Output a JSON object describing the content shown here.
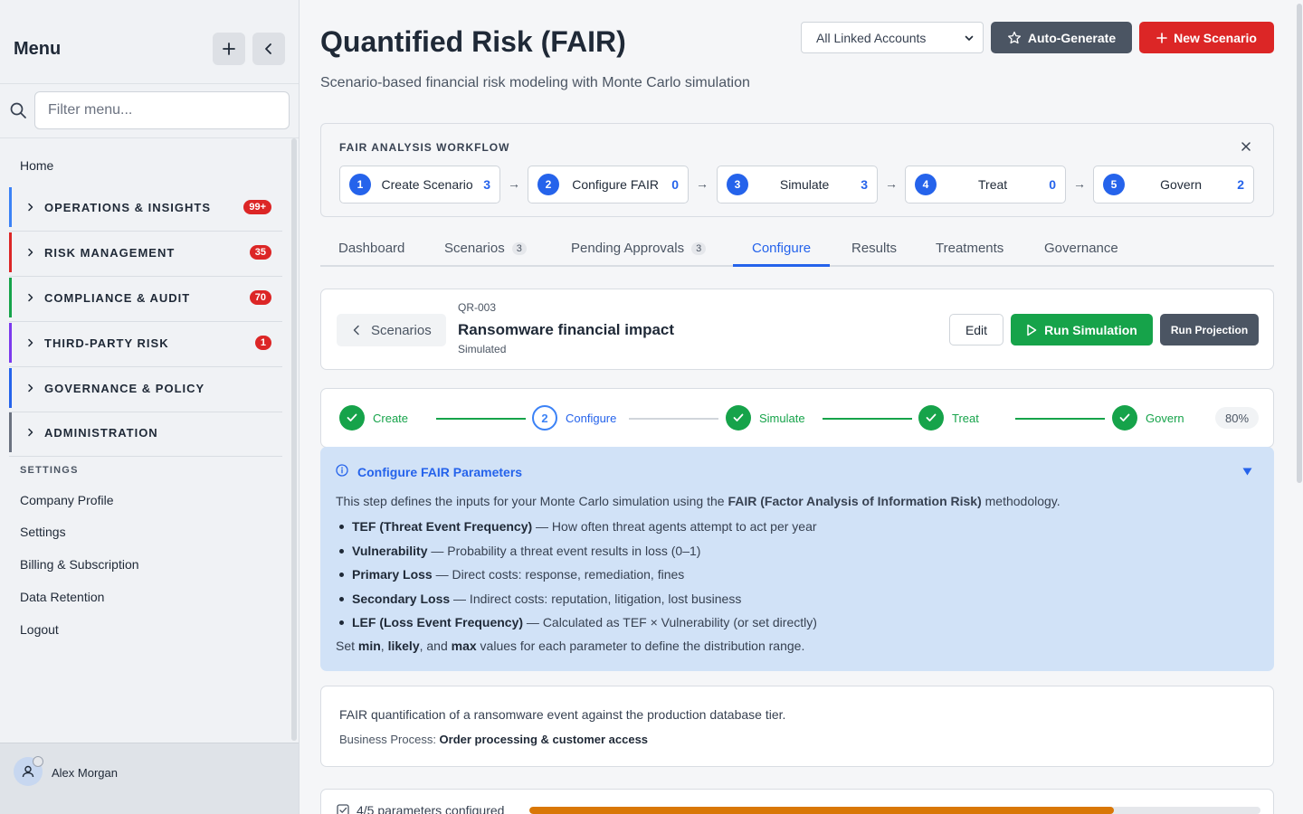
{
  "sidebar": {
    "title": "Menu",
    "search_placeholder": "Filter menu...",
    "home": "Home",
    "groups": [
      {
        "label": "OPERATIONS & INSIGHTS",
        "badge": "99+",
        "color": "#3b82f6"
      },
      {
        "label": "RISK MANAGEMENT",
        "badge": "35",
        "color": "#dc2626"
      },
      {
        "label": "COMPLIANCE & AUDIT",
        "badge": "70",
        "color": "#16a34a"
      },
      {
        "label": "THIRD-PARTY RISK",
        "badge": "1",
        "color": "#7c3aed"
      },
      {
        "label": "GOVERNANCE & POLICY",
        "badge": "",
        "color": "#2563eb"
      },
      {
        "label": "ADMINISTRATION",
        "badge": "",
        "color": "#6b7280"
      }
    ],
    "settings_heading": "SETTINGS",
    "settings_links": [
      "Company Profile",
      "Settings",
      "Billing & Subscription",
      "Data Retention",
      "Logout"
    ],
    "user_name": "Alex Morgan"
  },
  "header": {
    "title": "Quantified Risk (FAIR)",
    "subtitle": "Scenario-based financial risk modeling with Monte Carlo simulation",
    "account_select": "All Linked Accounts",
    "auto_generate": "Auto-Generate",
    "new_scenario": "New Scenario"
  },
  "workflow": {
    "label": "FAIR ANALYSIS WORKFLOW",
    "arrow": "→",
    "steps": [
      {
        "num": "1",
        "name": "Create Scenario",
        "count": "3"
      },
      {
        "num": "2",
        "name": "Configure FAIR",
        "count": "0"
      },
      {
        "num": "3",
        "name": "Simulate",
        "count": "3"
      },
      {
        "num": "4",
        "name": "Treat",
        "count": "0"
      },
      {
        "num": "5",
        "name": "Govern",
        "count": "2"
      }
    ]
  },
  "tabs": [
    {
      "label": "Dashboard",
      "count": ""
    },
    {
      "label": "Scenarios",
      "count": "3"
    },
    {
      "label": "Pending Approvals",
      "count": "3"
    },
    {
      "label": "Configure",
      "count": ""
    },
    {
      "label": "Results",
      "count": ""
    },
    {
      "label": "Treatments",
      "count": ""
    },
    {
      "label": "Governance",
      "count": ""
    }
  ],
  "active_tab": "Configure",
  "scenario": {
    "back_label": "Scenarios",
    "id": "QR-003",
    "title": "Ransomware financial impact",
    "status": "Simulated",
    "edit": "Edit",
    "run_simulation": "Run Simulation",
    "run_projection": "Run Projection"
  },
  "progress": {
    "steps": [
      {
        "label": "Create",
        "state": "done"
      },
      {
        "label": "Configure",
        "state": "current",
        "num": "2"
      },
      {
        "label": "Simulate",
        "state": "done"
      },
      {
        "label": "Treat",
        "state": "done"
      },
      {
        "label": "Govern",
        "state": "done"
      }
    ],
    "percent": "80%"
  },
  "info": {
    "title": "Configure FAIR Parameters",
    "intro_pre": "This step defines the inputs for your Monte Carlo simulation using the ",
    "intro_bold": "FAIR (Factor Analysis of Information Risk)",
    "intro_post": " methodology.",
    "items": [
      {
        "term": "TEF (Threat Event Frequency)",
        "desc": " — How often threat agents attempt to act per year"
      },
      {
        "term": "Vulnerability",
        "desc": " — Probability a threat event results in loss (0–1)"
      },
      {
        "term": "Primary Loss",
        "desc": " — Direct costs: response, remediation, fines"
      },
      {
        "term": "Secondary Loss",
        "desc": " — Indirect costs: reputation, litigation, lost business"
      },
      {
        "term": "LEF (Loss Event Frequency)",
        "desc": " — Calculated as TEF × Vulnerability (or set directly)"
      }
    ],
    "foot": {
      "p1": "Set ",
      "b1": "min",
      "p2": ", ",
      "b2": "likely",
      "p3": ", and ",
      "b3": "max",
      "p4": " values for each parameter to define the distribution range."
    }
  },
  "description": {
    "text": "FAIR quantification of a ransomware event against the production database tier.",
    "bp_label": "Business Process: ",
    "bp_value": "Order processing & customer access"
  },
  "parameters": {
    "label": "4/5 parameters configured",
    "fraction": 0.8
  }
}
